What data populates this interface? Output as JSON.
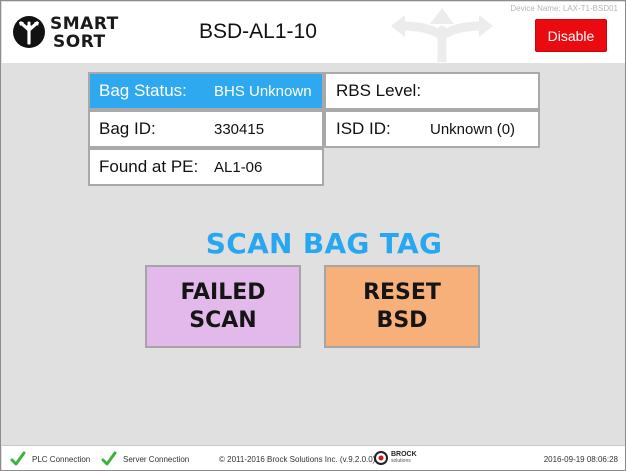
{
  "header": {
    "logo_line1": "SMART",
    "logo_line2": "SORT",
    "title": "BSD-AL1-10",
    "device_name": "Device Name: LAX-T1-BSD01",
    "disable_label": "Disable"
  },
  "info": {
    "bag_status_label": "Bag Status:",
    "bag_status_value": "BHS Unknown",
    "rbs_level_label": "RBS Level:",
    "rbs_level_value": "",
    "bag_id_label": "Bag ID:",
    "bag_id_value": "330415",
    "isd_id_label": "ISD ID:",
    "isd_id_value": "Unknown (0)",
    "found_at_label": "Found at PE:",
    "found_at_value": "AL1-06"
  },
  "main": {
    "prompt": "SCAN BAG TAG",
    "failed_line1": "FAILED",
    "failed_line2": "SCAN",
    "reset_line1": "RESET",
    "reset_line2": "BSD"
  },
  "footer": {
    "plc_label": "PLC Connection",
    "server_label": "Server Connection",
    "copyright": "© 2011-2016 Brock Solutions Inc. (v.9.2.0.0)",
    "brand_line1": "BROCK",
    "brand_line2": "solutions",
    "timestamp": "2016-09-19 08:06:28"
  },
  "colors": {
    "active_cell": "#2ea9f0",
    "prompt": "#27a7ef",
    "disable": "#ea0a0f",
    "failed_button": "#e2b9ea",
    "reset_button": "#f8b07a",
    "status_ok": "#3cb43c"
  },
  "icons": {
    "logo": "smart-sort-logo-icon",
    "watermark": "sorting-arrows-icon",
    "plc_status": "checkmark-icon",
    "server_status": "checkmark-icon",
    "brand": "brock-logo-icon"
  }
}
